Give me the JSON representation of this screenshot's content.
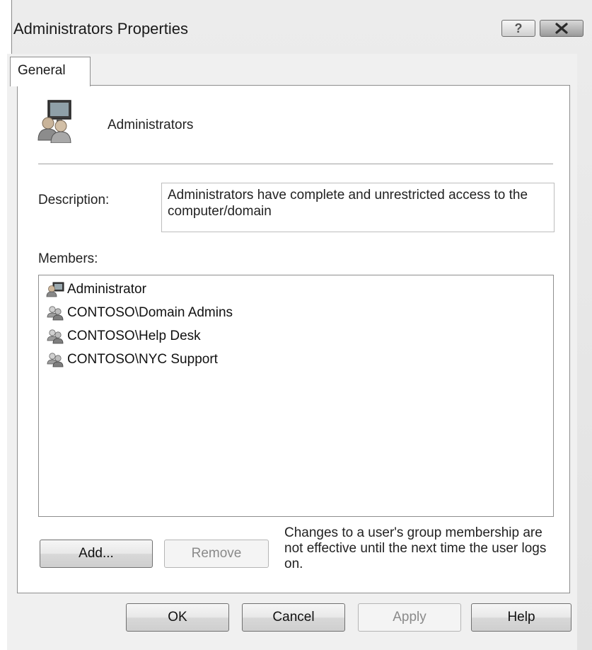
{
  "window": {
    "title": "Administrators Properties"
  },
  "title_buttons": {
    "help_icon": "question-mark-icon",
    "close_icon": "close-x-icon"
  },
  "tabs": [
    {
      "label": "General",
      "selected": true
    }
  ],
  "group": {
    "icon": "group-users-icon",
    "name": "Administrators"
  },
  "description": {
    "label": "Description:",
    "value": "Administrators have complete and unrestricted access to the computer/domain"
  },
  "members": {
    "label": "Members:",
    "items": [
      {
        "name": "Administrator",
        "icon": "user-icon"
      },
      {
        "name": "CONTOSO\\Domain Admins",
        "icon": "group-icon"
      },
      {
        "name": "CONTOSO\\Help Desk",
        "icon": "group-icon"
      },
      {
        "name": "CONTOSO\\NYC Support",
        "icon": "group-icon"
      }
    ]
  },
  "member_buttons": {
    "add_label": "Add...",
    "remove_label": "Remove"
  },
  "note": "Changes to a user's group membership are not effective until the next time the user logs on.",
  "dialog_buttons": {
    "ok_label": "OK",
    "cancel_label": "Cancel",
    "apply_label": "Apply",
    "help_label": "Help"
  }
}
